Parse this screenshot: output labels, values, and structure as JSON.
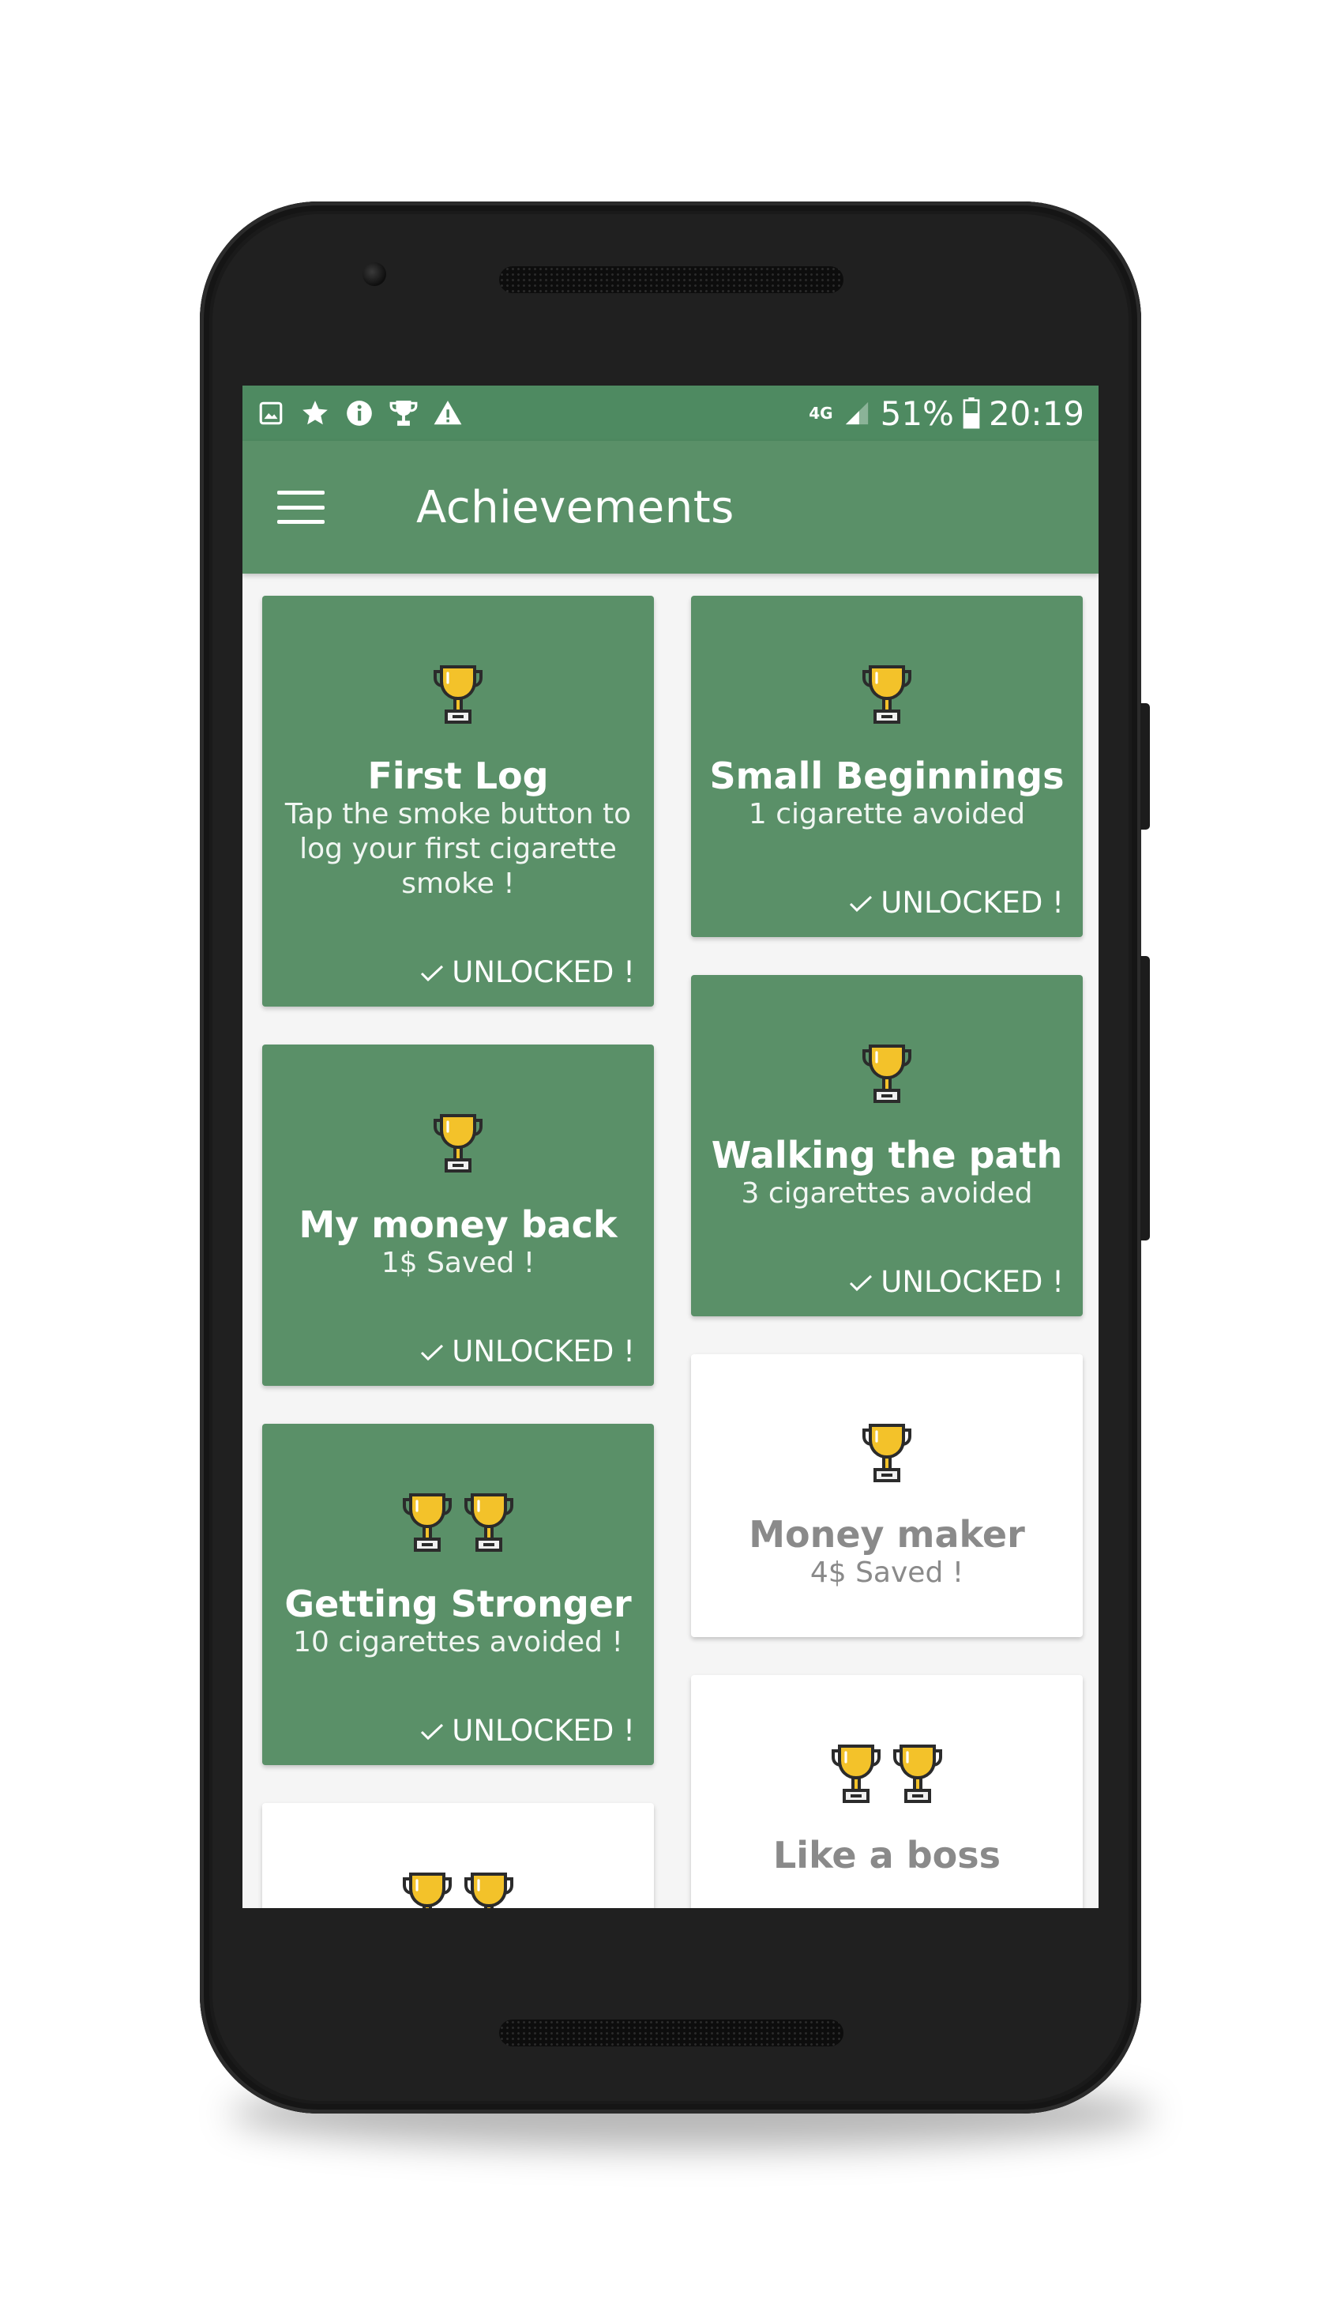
{
  "status_bar": {
    "left_icons": [
      "image-icon",
      "star-icon",
      "info-icon",
      "trophy-icon",
      "warning-icon"
    ],
    "network": "4G",
    "battery": "51%",
    "time": "20:19"
  },
  "appbar": {
    "title": "Achievements"
  },
  "achievements": [
    {
      "title": "First Log",
      "description": "Tap the smoke button to log your first cigarette smoke !",
      "status": "UNLOCKED !",
      "trophies": 1,
      "unlocked": true
    },
    {
      "title": "Small Beginnings",
      "description": "1 cigarette avoided",
      "status": "UNLOCKED !",
      "trophies": 1,
      "unlocked": true
    },
    {
      "title": "My money back",
      "description": "1$ Saved !",
      "status": "UNLOCKED !",
      "trophies": 1,
      "unlocked": true
    },
    {
      "title": "Walking the path",
      "description": "3 cigarettes avoided",
      "status": "UNLOCKED !",
      "trophies": 1,
      "unlocked": true
    },
    {
      "title": "Getting Stronger",
      "description": "10 cigarettes avoided !",
      "status": "UNLOCKED !",
      "trophies": 2,
      "unlocked": true
    },
    {
      "title": "Money maker",
      "description": "4$ Saved !",
      "status": "",
      "trophies": 1,
      "unlocked": false
    },
    {
      "title": "",
      "description": "",
      "status": "",
      "trophies": 2,
      "unlocked": false
    },
    {
      "title": "Like a boss",
      "description": "",
      "status": "",
      "trophies": 2,
      "unlocked": false
    }
  ],
  "colors": {
    "primary": "#5a9068",
    "primary_dark": "#4e8a61",
    "trophy_gold": "#f3c22a",
    "locked_text": "#8a8a8a"
  }
}
